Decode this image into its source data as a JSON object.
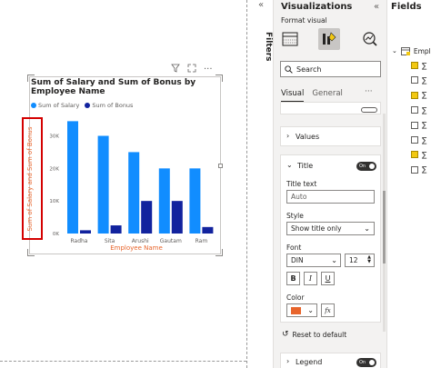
{
  "canvas": {
    "chart": {
      "title": "Sum of Salary and Sum of Bonus by Employee Name",
      "colors": {
        "salary": "#118DFF",
        "bonus": "#12239E",
        "axis_title": "#E8652C"
      }
    }
  },
  "chart_data": {
    "type": "bar",
    "title": "Sum of Salary and Sum of Bonus by Employee Name",
    "xlabel": "Employee Name",
    "ylabel": "Sum of Salary and Sum of Bonus",
    "categories": [
      "Radha",
      "Sita",
      "Arushi",
      "Gautam",
      "Ram"
    ],
    "series": [
      {
        "name": "Sum of Salary",
        "values": [
          34500,
          30000,
          25000,
          20000,
          20000
        ]
      },
      {
        "name": "Sum of Bonus",
        "values": [
          1000,
          2500,
          10000,
          10000,
          2000
        ]
      }
    ],
    "yticks": [
      "0K",
      "10K",
      "20K",
      "30K"
    ],
    "ylim": [
      0,
      36000
    ],
    "legend": "top-left",
    "grid": false
  },
  "filters": {
    "label": "Filters"
  },
  "visualizations": {
    "title": "Visualizations",
    "subtitle": "Format visual",
    "search_placeholder": "Search",
    "tabs": {
      "visual": "Visual",
      "general": "General"
    },
    "values_section": "Values",
    "title_section": {
      "label": "Title",
      "toggle": "On",
      "title_text_label": "Title text",
      "title_text_value": "Auto",
      "style_label": "Style",
      "style_value": "Show title only",
      "font_label": "Font",
      "font_family": "DIN",
      "font_size": "12",
      "bold": "B",
      "italic": "I",
      "underline": "U",
      "color_label": "Color",
      "color_value": "#E8652C",
      "fx": "fx",
      "reset": "Reset to default"
    },
    "legend_section": {
      "label": "Legend",
      "toggle": "On"
    }
  },
  "fields": {
    "title": "Fields",
    "table_name": "Emplo",
    "rows": [
      {
        "checked": true
      },
      {
        "checked": false
      },
      {
        "checked": true
      },
      {
        "checked": false
      },
      {
        "checked": false
      },
      {
        "checked": false
      },
      {
        "checked": true
      },
      {
        "checked": false
      }
    ]
  }
}
